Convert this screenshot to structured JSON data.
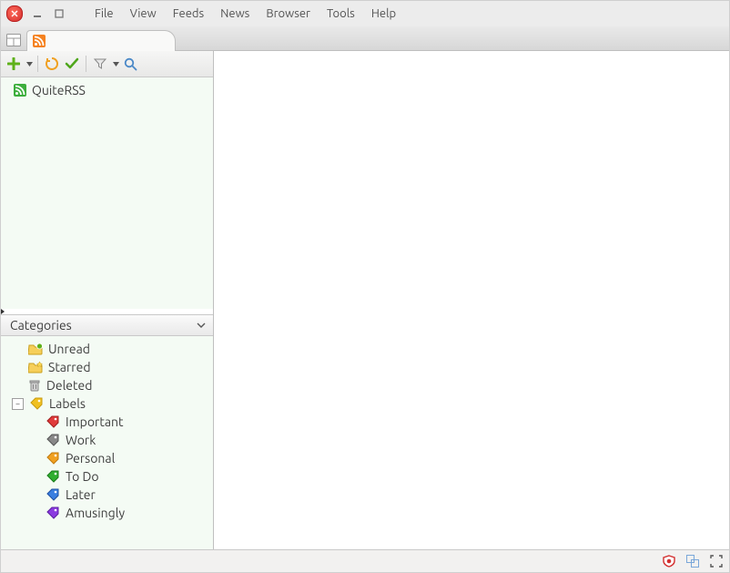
{
  "menubar": [
    "File",
    "View",
    "Feeds",
    "News",
    "Browser",
    "Tools",
    "Help"
  ],
  "tabs": {
    "active_icon": "rss"
  },
  "feeds": [
    {
      "icon": "rss-green",
      "label": "QuiteRSS"
    }
  ],
  "categories_header": "Categories",
  "categories": [
    {
      "icon": "folder-unread",
      "label": "Unread"
    },
    {
      "icon": "folder-star",
      "label": "Starred"
    },
    {
      "icon": "trash",
      "label": "Deleted"
    },
    {
      "icon": "tag-yellow",
      "label": "Labels",
      "expandable": true,
      "expanded": true,
      "children": [
        {
          "icon": "tag-red",
          "label": "Important"
        },
        {
          "icon": "tag-grey",
          "label": "Work"
        },
        {
          "icon": "tag-orange",
          "label": "Personal"
        },
        {
          "icon": "tag-green",
          "label": "To Do"
        },
        {
          "icon": "tag-blue",
          "label": "Later"
        },
        {
          "icon": "tag-purple",
          "label": "Amusingly"
        }
      ]
    }
  ],
  "colors": {
    "tag-red": "#e03a3a",
    "tag-grey": "#777777",
    "tag-orange": "#f0a020",
    "tag-green": "#2fae2f",
    "tag-blue": "#3a7fe0",
    "tag-purple": "#8a3ae0",
    "tag-yellow": "#f0c020"
  }
}
